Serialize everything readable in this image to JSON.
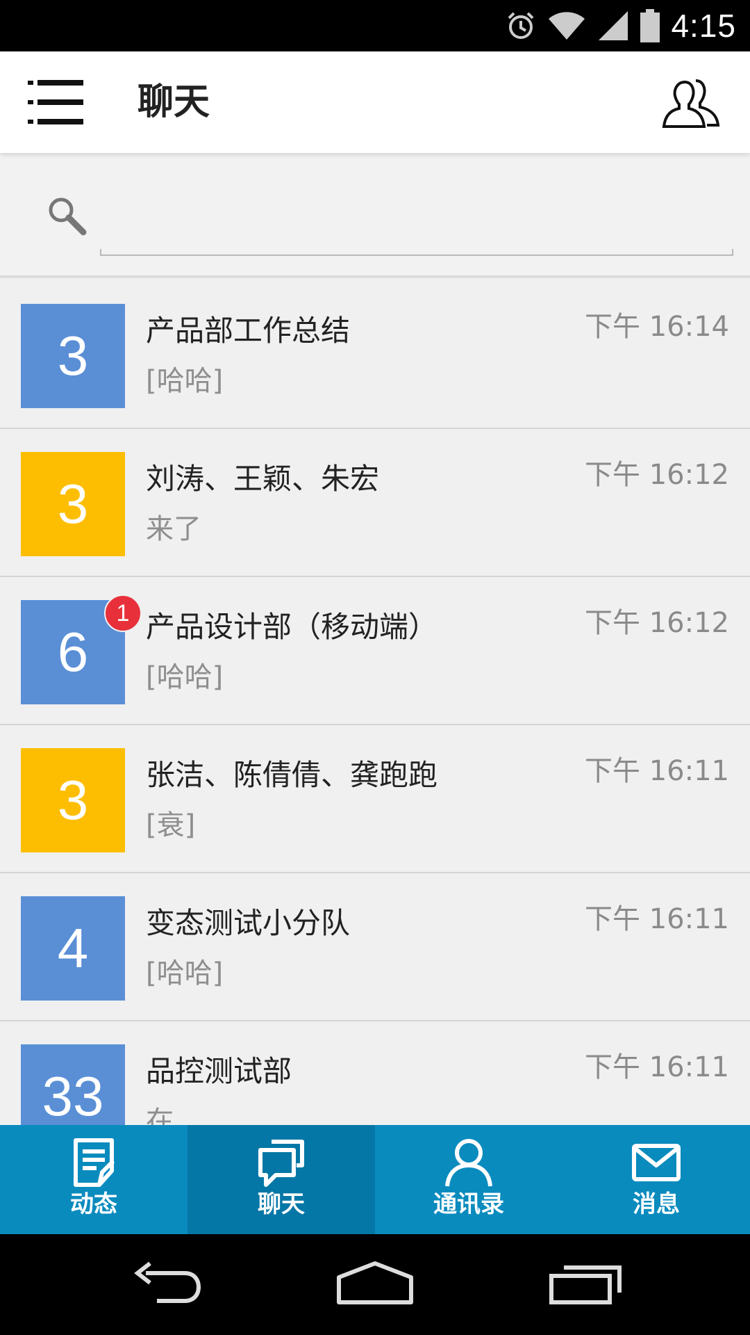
{
  "status_bar": {
    "time": "4:15",
    "icons": [
      "alarm-icon",
      "wifi-icon",
      "signal-icon",
      "battery-icon"
    ]
  },
  "header": {
    "title": "聊天",
    "menu_icon": "menu-icon",
    "contacts_icon": "group-icon"
  },
  "search": {
    "placeholder": "",
    "value": ""
  },
  "chats": [
    {
      "avatar_text": "3",
      "avatar_color": "#5a8fd6",
      "name": "产品部工作总结",
      "preview": "[哈哈]",
      "time": "下午 16:14",
      "unread": ""
    },
    {
      "avatar_text": "3",
      "avatar_color": "#fdbe02",
      "name": "刘涛、王颖、朱宏",
      "preview": "来了",
      "time": "下午 16:12",
      "unread": ""
    },
    {
      "avatar_text": "6",
      "avatar_color": "#5a8fd6",
      "name": "产品设计部（移动端）",
      "preview": "[哈哈]",
      "time": "下午 16:12",
      "unread": "1"
    },
    {
      "avatar_text": "3",
      "avatar_color": "#fdbe02",
      "name": "张洁、陈倩倩、龚跑跑",
      "preview": "[衰]",
      "time": "下午 16:11",
      "unread": ""
    },
    {
      "avatar_text": "4",
      "avatar_color": "#5a8fd6",
      "name": "变态测试小分队",
      "preview": "[哈哈]",
      "time": "下午 16:11",
      "unread": ""
    },
    {
      "avatar_text": "33",
      "avatar_color": "#5a8fd6",
      "name": "品控测试部",
      "preview": "在",
      "time": "下午 16:11",
      "unread": ""
    }
  ],
  "bottom_nav": {
    "tabs": [
      {
        "label": "动态",
        "icon": "note-edit-icon",
        "active": false
      },
      {
        "label": "聊天",
        "icon": "chat-bubbles-icon",
        "active": true
      },
      {
        "label": "通讯录",
        "icon": "person-icon",
        "active": false
      },
      {
        "label": "消息",
        "icon": "envelope-icon",
        "active": false
      }
    ]
  },
  "colors": {
    "nav_bg": "#0a8bbe",
    "nav_active_bg": "#0577a6",
    "badge": "#e8303a",
    "avatar_blue": "#5a8fd6",
    "avatar_yellow": "#fdbe02"
  }
}
